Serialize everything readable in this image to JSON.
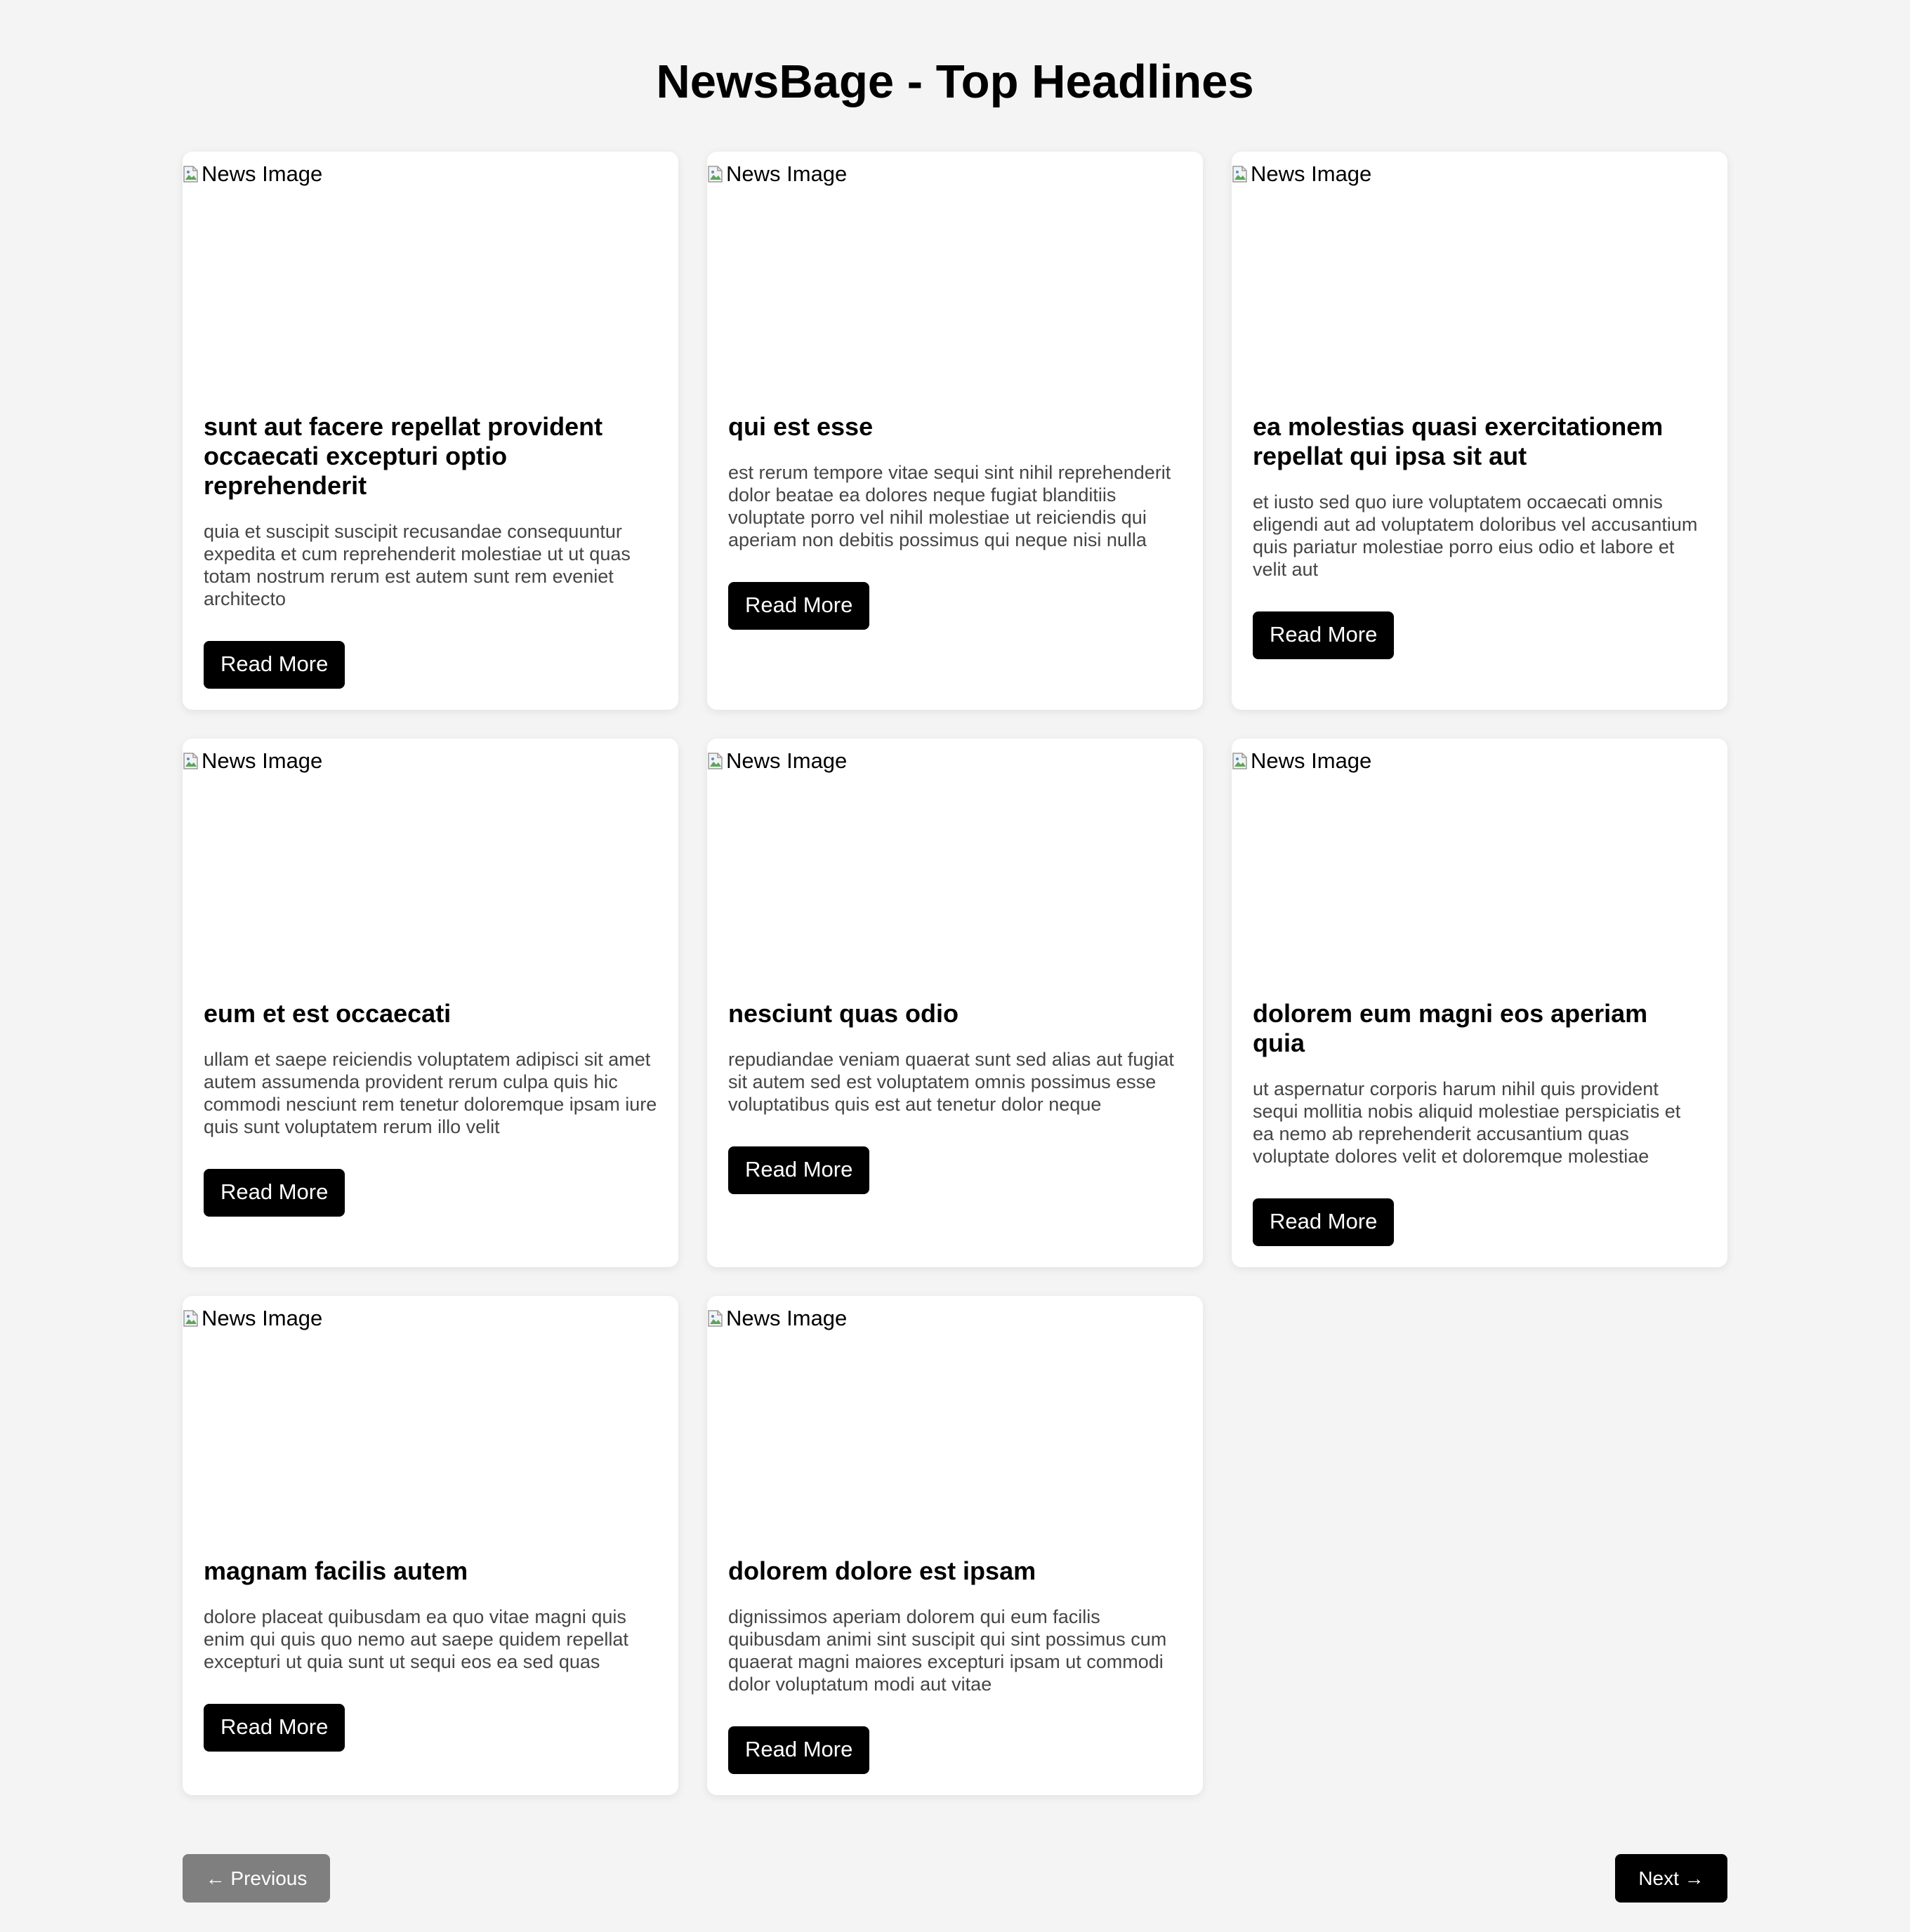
{
  "header": {
    "title": "NewsBage - Top Headlines"
  },
  "image_alt": "News Image",
  "articles": [
    {
      "title": "sunt aut facere repellat provident occaecati excepturi optio reprehenderit",
      "description": "quia et suscipit suscipit recusandae consequuntur expedita et cum reprehenderit molestiae ut ut quas totam nostrum rerum est autem sunt rem eveniet architecto",
      "button_label": "Read More"
    },
    {
      "title": "qui est esse",
      "description": "est rerum tempore vitae sequi sint nihil reprehenderit dolor beatae ea dolores neque fugiat blanditiis voluptate porro vel nihil molestiae ut reiciendis qui aperiam non debitis possimus qui neque nisi nulla",
      "button_label": "Read More"
    },
    {
      "title": "ea molestias quasi exercitationem repellat qui ipsa sit aut",
      "description": "et iusto sed quo iure voluptatem occaecati omnis eligendi aut ad voluptatem doloribus vel accusantium quis pariatur molestiae porro eius odio et labore et velit aut",
      "button_label": "Read More"
    },
    {
      "title": "eum et est occaecati",
      "description": "ullam et saepe reiciendis voluptatem adipisci sit amet autem assumenda provident rerum culpa quis hic commodi nesciunt rem tenetur doloremque ipsam iure quis sunt voluptatem rerum illo velit",
      "button_label": "Read More"
    },
    {
      "title": "nesciunt quas odio",
      "description": "repudiandae veniam quaerat sunt sed alias aut fugiat sit autem sed est voluptatem omnis possimus esse voluptatibus quis est aut tenetur dolor neque",
      "button_label": "Read More"
    },
    {
      "title": "dolorem eum magni eos aperiam quia",
      "description": "ut aspernatur corporis harum nihil quis provident sequi mollitia nobis aliquid molestiae perspiciatis et ea nemo ab reprehenderit accusantium quas voluptate dolores velit et doloremque molestiae",
      "button_label": "Read More"
    },
    {
      "title": "magnam facilis autem",
      "description": "dolore placeat quibusdam ea quo vitae magni quis enim qui quis quo nemo aut saepe quidem repellat excepturi ut quia sunt ut sequi eos ea sed quas",
      "button_label": "Read More"
    },
    {
      "title": "dolorem dolore est ipsam",
      "description": "dignissimos aperiam dolorem qui eum facilis quibusdam animi sint suscipit qui sint possimus cum quaerat magni maiores excepturi ipsam ut commodi dolor voluptatum modi aut vitae",
      "button_label": "Read More"
    }
  ],
  "pagination": {
    "previous_label": "← Previous",
    "next_label": "Next →"
  },
  "colors": {
    "page_background": "#f4f4f4",
    "card_background": "#ffffff",
    "button_background": "#000000",
    "previous_button_background": "#7f7f7f",
    "description_text": "#454545"
  },
  "icons": {
    "article_image": "broken-image-icon"
  }
}
